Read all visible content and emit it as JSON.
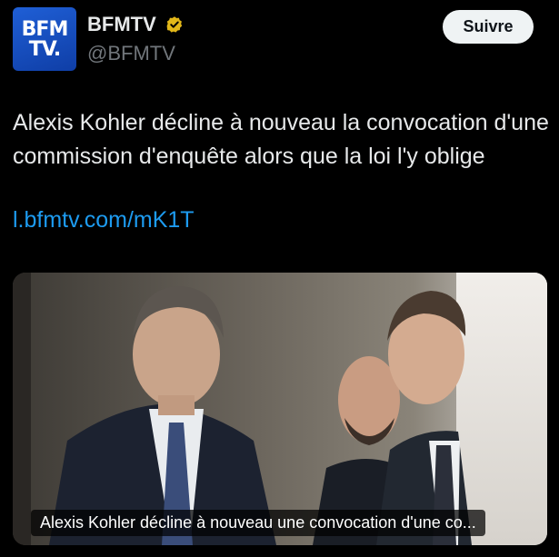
{
  "account": {
    "display_name": "BFMTV",
    "handle": "@BFMTV",
    "avatar_logo_line1": "BFM",
    "avatar_logo_line2": "TV.",
    "verified_icon": "verified-badge-icon",
    "verified_color": "#e2b719",
    "avatar_color": "#1f5fd6"
  },
  "follow_button": {
    "label": "Suivre"
  },
  "tweet": {
    "text": "Alexis Kohler décline à nouveau la convocation d'une commission d'enquête alors que la loi l'y oblige",
    "link": "l.bfmtv.com/mK1T",
    "link_color": "#1d9bf0"
  },
  "card": {
    "caption": "Alexis Kohler décline à nouveau une convocation d'une co..."
  }
}
